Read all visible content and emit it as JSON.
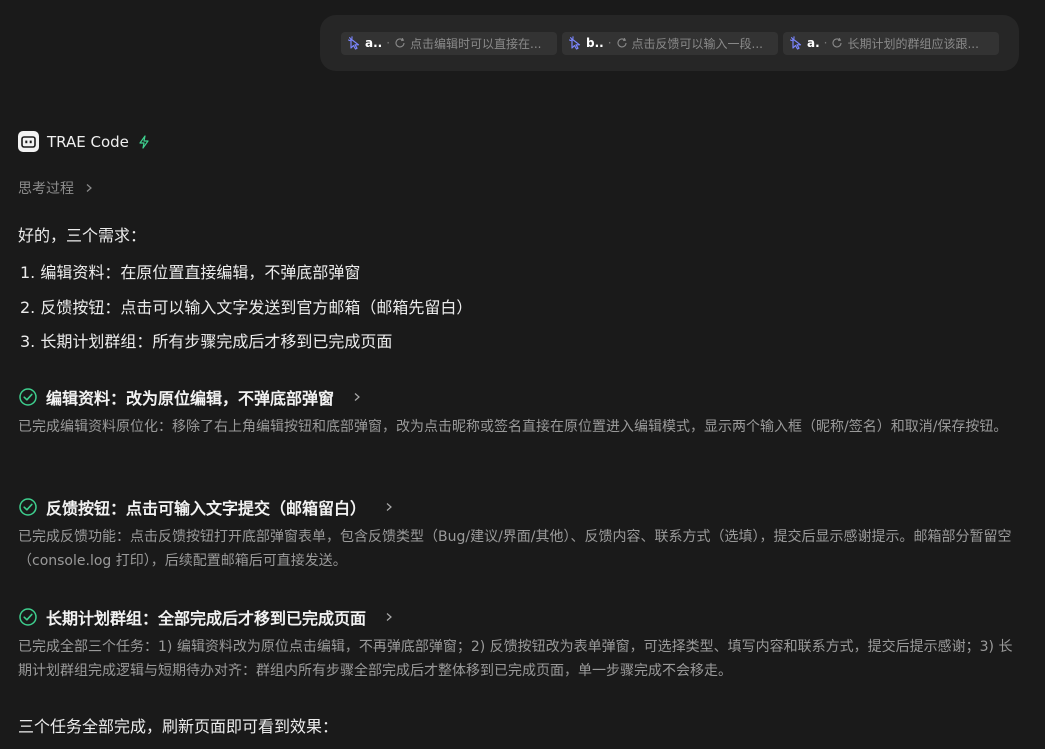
{
  "user_message": {
    "refs": [
      {
        "key": "a..",
        "text": "点击编辑时可以直接在..."
      },
      {
        "key": "b..",
        "text": "点击反馈可以输入一段..."
      },
      {
        "key": "a.",
        "text": "长期计划的群组应该跟..."
      }
    ]
  },
  "assistant": {
    "name": "TRAE Code",
    "thinking_label": "思考过程",
    "intro": "好的，三个需求：",
    "requirements": [
      "1. 编辑资料：在原位置直接编辑，不弹底部弹窗",
      "2. 反馈按钮：点击可以输入文字发送到官方邮箱（邮箱先留白）",
      "3. 长期计划群组：所有步骤完成后才移到已完成页面"
    ],
    "tasks": [
      {
        "title": "编辑资料：改为原位编辑，不弹底部弹窗",
        "desc": "已完成编辑资料原位化：移除了右上角编辑按钮和底部弹窗，改为点击昵称或签名直接在原位置进入编辑模式，显示两个输入框（昵称/签名）和取消/保存按钮。"
      },
      {
        "title": "反馈按钮：点击可输入文字提交（邮箱留白）",
        "desc": "已完成反馈功能：点击反馈按钮打开底部弹窗表单，包含反馈类型（Bug/建议/界面/其他）、反馈内容、联系方式（选填），提交后显示感谢提示。邮箱部分暂留空（console.log 打印），后续配置邮箱后可直接发送。"
      },
      {
        "title": "长期计划群组：全部完成后才移到已完成页面",
        "desc": "已完成全部三个任务：1) 编辑资料改为原位点击编辑，不再弹底部弹窗；2) 反馈按钮改为表单弹窗，可选择类型、填写内容和联系方式，提交后提示感谢；3) 长期计划群组完成逻辑与短期待办对齐：群组内所有步骤全部完成后才整体移到已完成页面，单一步骤完成不会移走。"
      }
    ],
    "closing": "三个任务全部完成，刷新页面即可看到效果："
  },
  "colors": {
    "background": "#1a1a1a",
    "bubble": "#262626",
    "chip": "#333333",
    "accent_green": "#3ecf8e",
    "cursor_blue": "#6b7bff"
  }
}
